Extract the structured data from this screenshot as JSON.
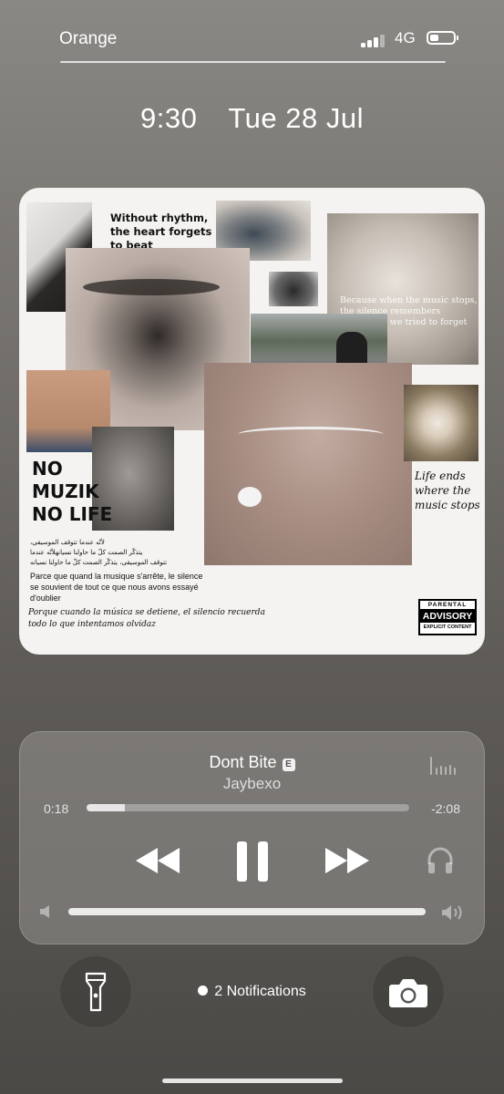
{
  "status_bar": {
    "carrier": "Orange",
    "network": "4G",
    "signal_bars_active": 3,
    "signal_bars_total": 4,
    "battery_level": 0.25
  },
  "lock_screen": {
    "time": "9:30",
    "date": "Tue 28 Jul"
  },
  "album_art": {
    "quote_1": "Without rhythm, the heart forgets to beat",
    "quote_2": "Because when the music stops, the silence remembers everything we tried to forget",
    "quote_3": "Life ends where the music stops",
    "slogan_line1": "NO",
    "slogan_line2": "MUZIK",
    "slogan_line3": "NO LIFE",
    "arabic_line1": "لأنّه عندما تتوقف الموسيقى،",
    "arabic_line2": "يتذكّر الصمت كلّ ما حاولنا نسيانهلأنّه عندما",
    "arabic_line3": "تتوقف الموسيقى، يتذكّر الصمت كلّ ما حاولنا نسيانه",
    "french_text": "Parce que quand la musique s'arrête, le silence se souvient de tout ce que nous avons essayé d'oublier",
    "spanish_text": "Porque cuando la música se detiene, el silencio recuerda todo lo que intentamos olvidaz",
    "advisory_top": "PARENTAL",
    "advisory_main": "ADVISORY",
    "advisory_bottom": "EXPLICIT CONTENT"
  },
  "now_playing": {
    "title": "Dont Bite",
    "explicit_badge": "E",
    "artist": "Jaybexo",
    "elapsed": "0:18",
    "remaining": "-2:08",
    "progress": 0.12,
    "volume": 1.0,
    "state": "playing"
  },
  "bottom": {
    "notifications_label": "2 Notifications"
  },
  "colors": {
    "background_top": "#8a8884",
    "background_bottom": "#4b4946",
    "foreground": "#ffffff"
  },
  "icons": [
    "flashlight-icon",
    "camera-icon",
    "rewind-icon",
    "pause-icon",
    "fast-forward-icon",
    "headphones-icon",
    "airplay-waveform-icon",
    "volume-low-icon",
    "volume-high-icon"
  ]
}
